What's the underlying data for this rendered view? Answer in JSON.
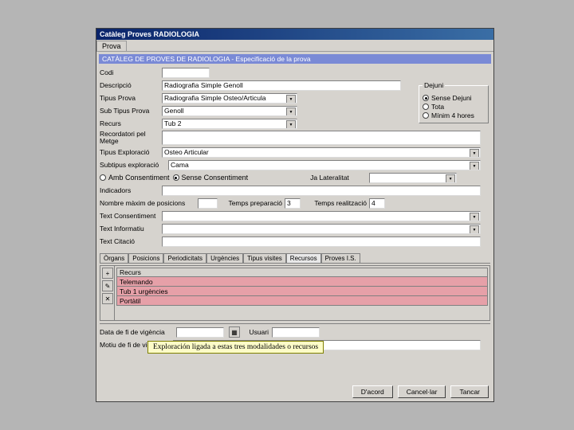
{
  "window": {
    "title": "Catàleg Proves RADIOLOGIA"
  },
  "main_tab": "Prova",
  "section": {
    "header": "CATÀLEG DE PROVES DE RADIOLOGIA - Especificació de la prova"
  },
  "labels": {
    "codi": "Codi",
    "descripcio": "Descripció",
    "tipus_prova": "Tipus Prova",
    "sub_tipus_prova": "Sub Tipus Prova",
    "recurs": "Recurs",
    "recordatori": "Recordatori pel Metge",
    "tipus_exploracio": "Tipus Exploració",
    "subtipus_exploracio": "Subtipus exploració",
    "amb_consentiment": "Amb Consentiment",
    "sense_consentiment": "Sense Consentiment",
    "ja_lateralitat": "Ja Lateralitat",
    "indicadors": "Indicadors",
    "nombre_max": "Nombre màxim de posicions",
    "temps_prep": "Temps preparació",
    "temps_real": "Temps realització",
    "text_consentiment": "Text Consentiment",
    "text_informatiu": "Text Informatiu",
    "text_citacio": "Text Citació",
    "data_fi": "Data de fi de vigència",
    "usuari": "Usuari",
    "motiu_fi": "Motiu de fi de vigència"
  },
  "values": {
    "codi": "",
    "descripcio": "Radiografia Simple Genoll",
    "tipus_prova": "Radiografia Simple Osteo/Articula",
    "sub_tipus_prova": "Genoll",
    "recurs": "Tub 2",
    "recordatori": "",
    "tipus_exploracio": "Osteo Articular",
    "subtipus_exploracio": "Cama",
    "ja_lateralitat": "",
    "indicadors": "",
    "nombre_max": "",
    "temps_prep": "3",
    "temps_real": "4",
    "text_consentiment": "",
    "text_informatiu": "",
    "text_citacio": "",
    "data_fi": "",
    "usuari": "",
    "motiu_fi": ""
  },
  "dejuni": {
    "legend": "Dejuni",
    "options": [
      "Sense Dejuni",
      "Tota",
      "Mínim 4 hores"
    ],
    "selected_index": 0
  },
  "inner_tabs": [
    "Òrgans",
    "Posicions",
    "Periodicitats",
    "Urgències",
    "Tipus visites",
    "Recursos",
    "Proves I.S."
  ],
  "inner_active": 5,
  "resources": {
    "header": "Recurs",
    "items": [
      "Telemando",
      "Tub 1 urgències",
      "Portàtil"
    ]
  },
  "note": "Exploración ligada a estas tres modalidades o recursos",
  "buttons": {
    "accord": "D'acord",
    "cancel": "Cancel·lar",
    "close": "Tancar"
  }
}
